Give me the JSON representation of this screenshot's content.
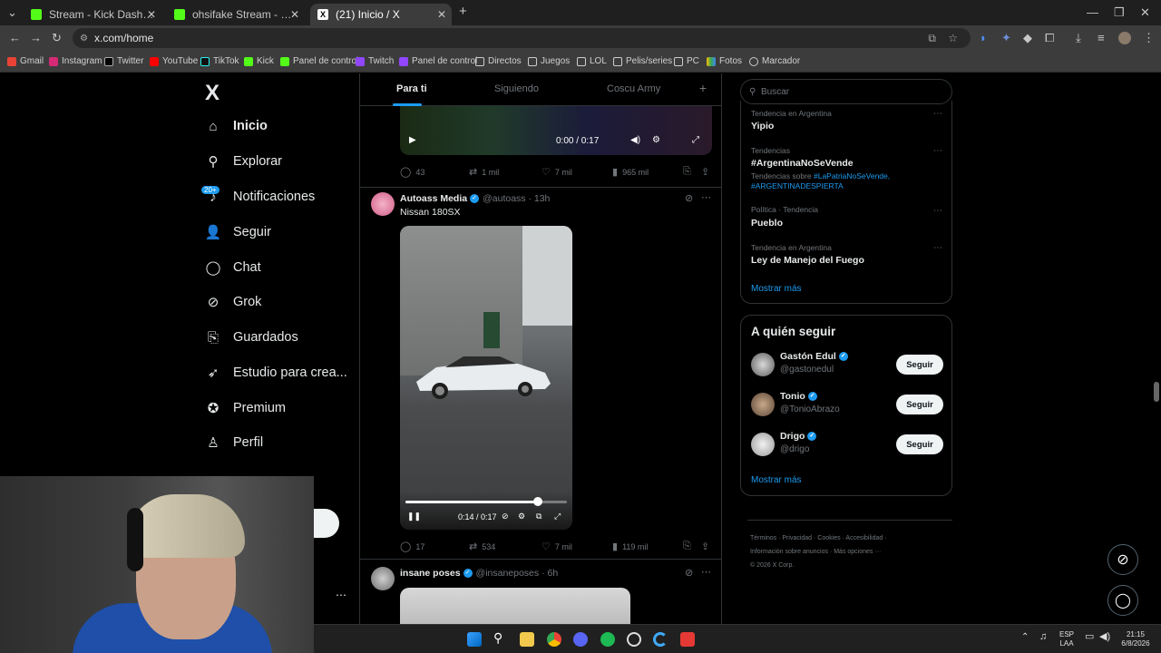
{
  "browser": {
    "tabs": [
      {
        "title": "Stream - Kick Dashboard",
        "favicon_color": "#53fc18"
      },
      {
        "title": "ohsifake Stream - Watch Live o",
        "favicon_color": "#53fc18"
      },
      {
        "title": "(21) Inicio / X",
        "favicon_color": "#000000"
      }
    ],
    "url": "x.com/home",
    "bookmarks": [
      "Gmail",
      "Instagram",
      "Twitter",
      "YouTube",
      "TikTok",
      "Kick",
      "Panel de control",
      "Twitch",
      "Panel de control",
      "Directos",
      "Juegos",
      "LOL",
      "Pelis/series",
      "PC",
      "Fotos",
      "Marcador"
    ]
  },
  "sidebar": {
    "logo": "X",
    "badge": "20+",
    "items": [
      {
        "label": "Inicio",
        "icon": "home-icon"
      },
      {
        "label": "Explorar",
        "icon": "search-icon"
      },
      {
        "label": "Notificaciones",
        "icon": "bell-icon"
      },
      {
        "label": "Seguir",
        "icon": "person-add-icon"
      },
      {
        "label": "Chat",
        "icon": "chat-icon"
      },
      {
        "label": "Grok",
        "icon": "grok-icon"
      },
      {
        "label": "Guardados",
        "icon": "bookmark-icon"
      },
      {
        "label": "Estudio para crea...",
        "icon": "rocket-icon"
      },
      {
        "label": "Premium",
        "icon": "premium-icon"
      },
      {
        "label": "Perfil",
        "icon": "profile-icon"
      }
    ]
  },
  "feed": {
    "tabs": [
      "Para ti",
      "Siguiendo",
      "Coscu Army"
    ],
    "first_post": {
      "video_time": "0:00 / 0:17",
      "replies": "43",
      "reposts": "1 mil",
      "likes": "7 mil",
      "views": "965 mil"
    },
    "post": {
      "author": "Autoass Media",
      "handle": "@autoass",
      "time": "· 13h",
      "text": "Nissan 180SX",
      "video_time": "0:14 / 0:17",
      "progress": 0.82,
      "replies": "17",
      "reposts": "534",
      "likes": "7 mil",
      "views": "119 mil"
    },
    "next_post": {
      "author": "insane poses",
      "handle": "@insaneposes",
      "time": "· 6h"
    }
  },
  "right": {
    "search_placeholder": "Buscar",
    "trends": [
      {
        "meta": "Tendencia en Argentina",
        "title": "Yipio"
      },
      {
        "meta": "Tendencias",
        "title": "#ArgentinaNoSeVende",
        "sub_prefix": "Tendencias sobre ",
        "sub_tags": "#LaPatriaNoSeVende, #ARGENTINADESPIERTA"
      },
      {
        "meta": "Política · Tendencia",
        "title": "Pueblo"
      },
      {
        "meta": "Tendencia en Argentina",
        "title": "Ley de Manejo del Fuego"
      }
    ],
    "show_more": "Mostrar más",
    "who_title": "A quién seguir",
    "who": [
      {
        "name": "Gastón Edul",
        "handle": "@gastonedul",
        "button": "Seguir"
      },
      {
        "name": "Tonio",
        "handle": "@TonioAbrazo",
        "button": "Seguir"
      },
      {
        "name": "Drigo",
        "handle": "@drigo",
        "button": "Seguir"
      }
    ],
    "who_more": "Mostrar más",
    "footer_line1": "Términos · Privacidad · Cookies · Accesibilidad ·",
    "footer_line2": "Información sobre anuncios · Más opciones ···",
    "footer_line3": "© 2026 X Corp."
  },
  "taskbar": {
    "lang": "ESP",
    "lang_sub": "LAA",
    "time": "21:15",
    "date": "6/8/2026"
  }
}
